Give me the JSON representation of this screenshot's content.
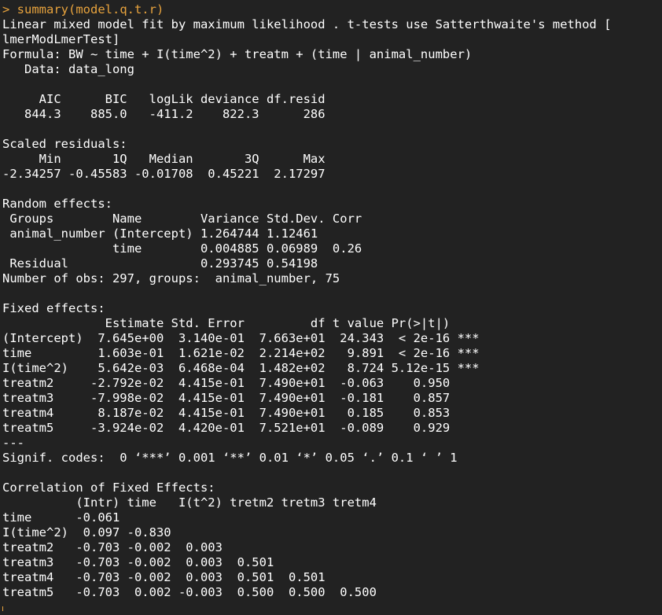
{
  "colors": {
    "background": "#222222",
    "output_text": "#ffffff",
    "command_text": "#e8a33d"
  },
  "console": {
    "prompt": "> ",
    "command": "summary(model.q.t.r)",
    "output_lines": [
      "Linear mixed model fit by maximum likelihood . t-tests use Satterthwaite's method [",
      "lmerModLmerTest]",
      "Formula: BW ~ time + I(time^2) + treatm + (time | animal_number)",
      "   Data: data_long",
      "",
      "     AIC      BIC   logLik deviance df.resid ",
      "   844.3    885.0   -411.2    822.3      286 ",
      "",
      "Scaled residuals: ",
      "     Min       1Q   Median       3Q      Max ",
      "-2.34257 -0.45583 -0.01708  0.45221  2.17297 ",
      "",
      "Random effects:",
      " Groups        Name        Variance Std.Dev. Corr",
      " animal_number (Intercept) 1.264744 1.12461      ",
      "               time        0.004885 0.06989  0.26",
      " Residual                  0.293745 0.54198      ",
      "Number of obs: 297, groups:  animal_number, 75",
      "",
      "Fixed effects:",
      "              Estimate Std. Error         df t value Pr(>|t|)    ",
      "(Intercept)  7.645e+00  3.140e-01  7.663e+01  24.343  < 2e-16 ***",
      "time         1.603e-01  1.621e-02  2.214e+02   9.891  < 2e-16 ***",
      "I(time^2)    5.642e-03  6.468e-04  1.482e+02   8.724 5.12e-15 ***",
      "treatm2     -2.792e-02  4.415e-01  7.490e+01  -0.063    0.950    ",
      "treatm3     -7.998e-02  4.415e-01  7.490e+01  -0.181    0.857    ",
      "treatm4      8.187e-02  4.415e-01  7.490e+01   0.185    0.853    ",
      "treatm5     -3.924e-02  4.420e-01  7.521e+01  -0.089    0.929    ",
      "---",
      "Signif. codes:  0 ‘***’ 0.001 ‘**’ 0.01 ‘*’ 0.05 ‘.’ 0.1 ‘ ’ 1",
      "",
      "Correlation of Fixed Effects:",
      "          (Intr) time   I(t^2) tretm2 tretm3 tretm4",
      "time      -0.061                                   ",
      "I(time^2)  0.097 -0.830                            ",
      "treatm2   -0.703 -0.002  0.003                     ",
      "treatm3   -0.703 -0.002  0.003  0.501              ",
      "treatm4   -0.703 -0.002  0.003  0.501  0.501       ",
      "treatm5   -0.703  0.002 -0.003  0.500  0.500  0.500"
    ]
  }
}
